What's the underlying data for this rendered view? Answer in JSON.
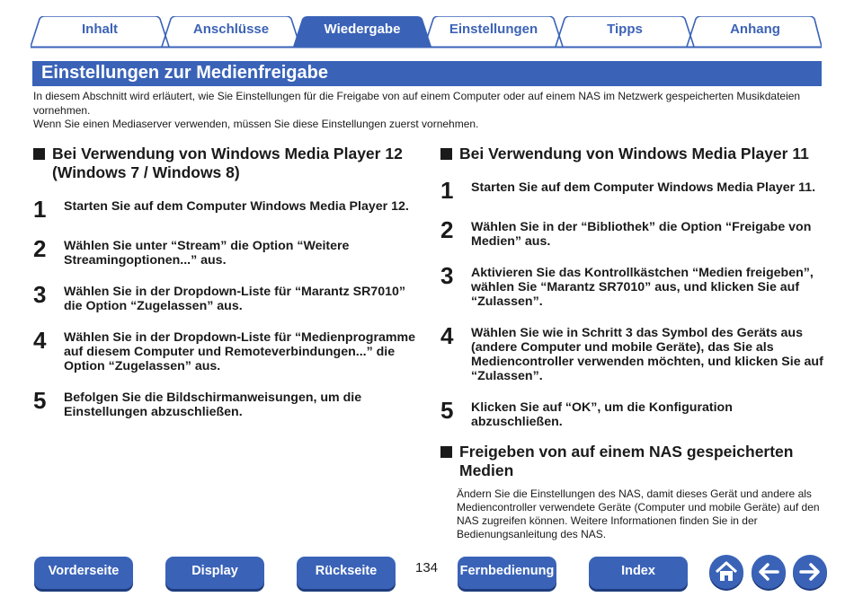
{
  "tabs": [
    {
      "label": "Inhalt",
      "active": false
    },
    {
      "label": "Anschlüsse",
      "active": false
    },
    {
      "label": "Wiedergabe",
      "active": true
    },
    {
      "label": "Einstellungen",
      "active": false
    },
    {
      "label": "Tipps",
      "active": false
    },
    {
      "label": "Anhang",
      "active": false
    }
  ],
  "title": "Einstellungen zur Medienfreigabe",
  "intro": {
    "p1": "In diesem Abschnitt wird erläutert, wie Sie Einstellungen für die Freigabe von auf einem Computer oder auf einem NAS im Netzwerk gespeicherten Musikdateien vornehmen.",
    "p2": "Wenn Sie einen Mediaserver verwenden, müssen Sie diese Einstellungen zuerst vornehmen."
  },
  "wmp12": {
    "heading_line1": "Bei Verwendung von Windows Media Player 12",
    "heading_line2": "(Windows 7 / Windows 8)",
    "steps": [
      {
        "num": "1",
        "text": "Starten Sie auf dem Computer Windows Media Player 12."
      },
      {
        "num": "2",
        "text": "Wählen Sie unter “Stream” die Option “Weitere Streamingoptionen...” aus."
      },
      {
        "num": "3",
        "text": "Wählen Sie in der Dropdown-Liste für “Marantz SR7010” die Option “Zugelassen” aus."
      },
      {
        "num": "4",
        "text": "Wählen Sie in der Dropdown-Liste für “Medienprogramme auf diesem Computer und Remoteverbindungen...” die Option “Zugelassen” aus."
      },
      {
        "num": "5",
        "text": "Befolgen Sie die Bildschirmanweisungen, um die Einstellungen abzuschließen."
      }
    ]
  },
  "wmp11": {
    "heading": "Bei Verwendung von Windows Media Player 11",
    "steps": [
      {
        "num": "1",
        "text": "Starten Sie auf dem Computer Windows Media Player 11."
      },
      {
        "num": "2",
        "text": "Wählen Sie in der “Bibliothek” die Option “Freigabe von Medien” aus."
      },
      {
        "num": "3",
        "text": "Aktivieren Sie das Kontrollkästchen “Medien freigeben”, wählen Sie “Marantz SR7010” aus, und klicken Sie auf “Zulassen”."
      },
      {
        "num": "4",
        "text": "Wählen Sie wie in Schritt 3 das Symbol des Geräts aus (andere Computer und mobile Geräte), das Sie als Mediencontroller verwenden möchten, und klicken Sie auf “Zulassen”."
      },
      {
        "num": "5",
        "text": "Klicken Sie auf “OK”, um die Konfiguration abzuschließen."
      }
    ]
  },
  "nas": {
    "heading_line1": "Freigeben von auf einem NAS gespeicherten",
    "heading_line2": "Medien",
    "body": "Ändern Sie die Einstellungen des NAS, damit dieses Gerät und andere als Mediencontroller verwendete Geräte (Computer und mobile Geräte) auf den NAS zugreifen können. Weitere Informationen finden Sie in der Bedienungsanleitung des NAS."
  },
  "footer": {
    "front_panel": "Vorderseite",
    "display": "Display",
    "rear_panel": "Rückseite",
    "page_number": "134",
    "remote": "Fernbedienung",
    "index": "Index",
    "home_icon": "home-icon",
    "back_icon": "arrow-left-icon",
    "forward_icon": "arrow-right-icon"
  },
  "colors": {
    "accent": "#3a63b8",
    "accent_dark": "#1e3c7e",
    "text": "#1a1a1a"
  }
}
